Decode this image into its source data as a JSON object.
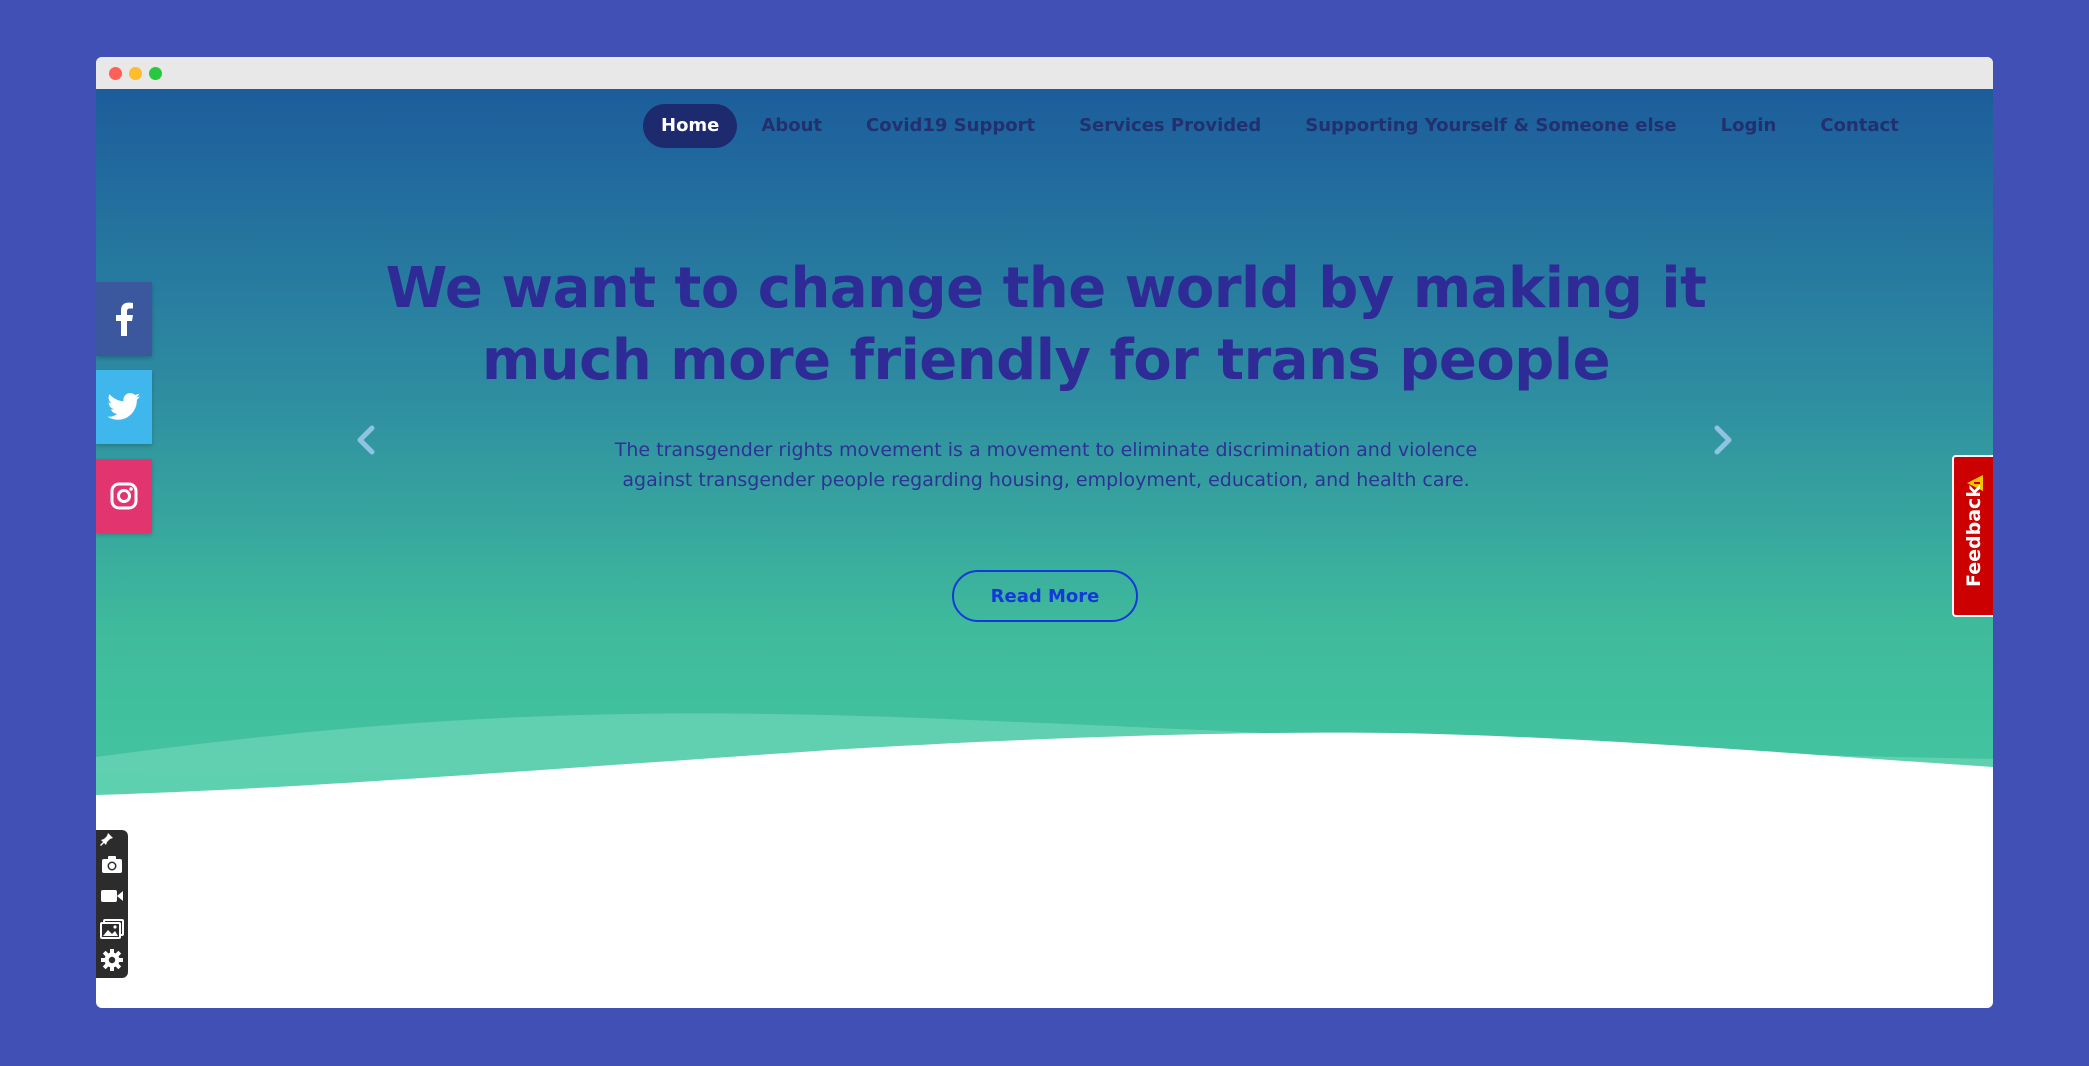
{
  "nav": {
    "items": [
      {
        "label": "Home",
        "active": true
      },
      {
        "label": "About"
      },
      {
        "label": "Covid19 Support"
      },
      {
        "label": "Services Provided"
      },
      {
        "label": "Supporting Yourself & Someone else"
      },
      {
        "label": "Login"
      },
      {
        "label": "Contact"
      }
    ]
  },
  "hero": {
    "headline": "We want to change the world by making it much more friendly for trans people",
    "subtext": "The transgender rights movement is a movement to eliminate discrimination and violence against transgender people regarding housing, employment, education, and health care.",
    "button_label": "Read More",
    "prev_icon": "chevron-left-icon",
    "next_icon": "chevron-right-icon"
  },
  "social": [
    {
      "icon": "facebook-icon",
      "color": "#3b579d"
    },
    {
      "icon": "twitter-icon",
      "color": "#40b7ec"
    },
    {
      "icon": "instagram-icon",
      "color": "#e2356f"
    }
  ],
  "feedback": {
    "label": "Feedback",
    "color": "#cc0000",
    "icon": "warning-icon"
  },
  "toolbox": {
    "icons": [
      "pin-icon",
      "camera-icon",
      "video-icon",
      "gallery-icon",
      "gear-icon"
    ]
  },
  "colors": {
    "page_bg": "#4050b5",
    "nav_active_bg": "#1e2a6e",
    "headline": "#2e2a96",
    "button": "#1339d8",
    "hero_gradient_top": "#1c5d9c",
    "hero_gradient_bottom": "#43c6a0"
  }
}
